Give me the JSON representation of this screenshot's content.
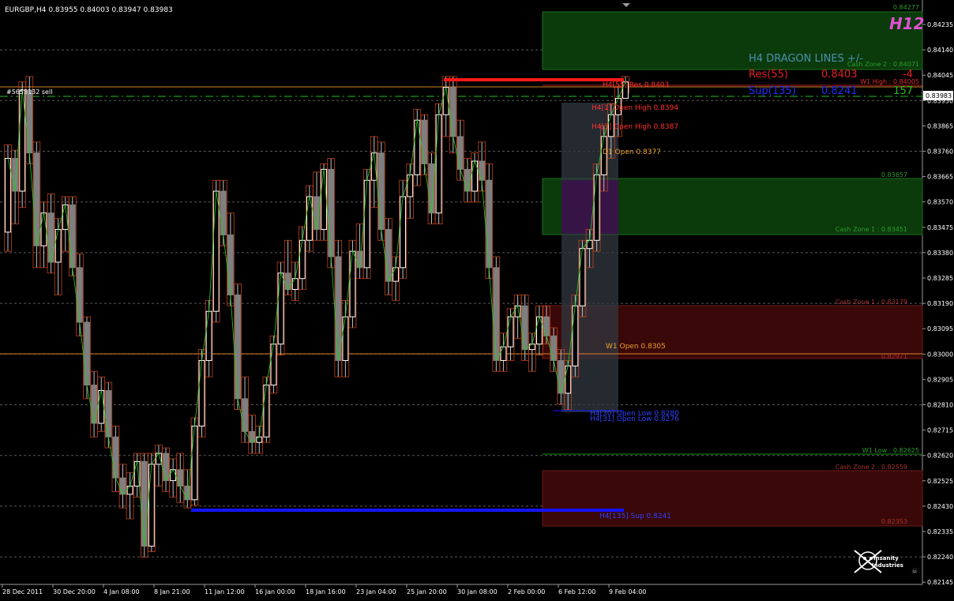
{
  "header": {
    "symbol_line": "EURGBP,H4  0.83955 0.84003 0.83947 0.83983",
    "order_label": "#5653132 sell"
  },
  "price_axis": {
    "ticks": [
      "0.84235",
      "0.84140",
      "0.84045",
      "0.83950",
      "0.83865",
      "0.83760",
      "0.83665",
      "0.83570",
      "0.83475",
      "0.83380",
      "0.83285",
      "0.83190",
      "0.83095",
      "0.83000",
      "0.82905",
      "0.82810",
      "0.82715",
      "0.82620",
      "0.82525",
      "0.82430",
      "0.82335",
      "0.82240",
      "0.82145"
    ],
    "current_price": "0.83983",
    "top_value": "0.84277"
  },
  "time_axis": {
    "ticks": [
      "28 Dec 2011",
      "30 Dec 20:00",
      "4 Jan 08:00",
      "8 Jan 21:00",
      "11 Jan 12:00",
      "16 Jan 00:00",
      "18 Jan 16:00",
      "23 Jan 04:00",
      "25 Jan 20:00",
      "30 Jan 08:00",
      "2 Feb 00:00",
      "6 Feb 12:00",
      "9 Feb 04:00"
    ]
  },
  "panel": {
    "timeframe_badge": "H12",
    "title": "H4  DRAGON LINES +/-",
    "res_label": "Res(55)",
    "res_value": "0.8403",
    "res_diff": "-4",
    "sup_label": "Sup(135)",
    "sup_value": "0.8241",
    "sup_diff": "157"
  },
  "zones": {
    "zone_top_value": "0.84277",
    "cash_zone_2_upper": "Cash Zone 2 : 0.84071",
    "w1_high": "W1 High : 0.84005",
    "green_value": "0.83657",
    "cash_zone_1_upper": "Cash Zone 1 : 0.83451",
    "cash_zone_1_lower": "Cash Zone 1 : 0.83179",
    "red_mid_value": "0.82971",
    "w1_low": "W1 Low : 0.82625",
    "cash_zone_2_lower": "Cash Zone 2 : 0.82559",
    "red_bottom_value": "0.82353"
  },
  "lines": {
    "res_line": "H4[55] Res 0.8403",
    "open_high_1": "H4[1] Open High 0.8394",
    "open_high_2": "H4[3] Open High 0.8387",
    "d1_open": "D1 Open 0.8377",
    "w1_open": "W1 Open 0.8305",
    "open_low_1": "H4[30] Open Low 0.8280",
    "open_low_2": "H4[31] Open Low 0.8276",
    "sup_line": "H4[135] Sup 0.8241"
  },
  "logo": {
    "line1": "Insanity",
    "line2": "Industries"
  },
  "colors": {
    "background": "#000000",
    "bull_candle": "#ffffff",
    "bear_candle": "#7f7f7f",
    "resistance": "#ff2020",
    "support": "#1a1aff",
    "zone_green": "#0a3a0a",
    "zone_red": "#3a0808",
    "orange_line": "#d9822b"
  },
  "chart_data": {
    "type": "candlestick",
    "symbol": "EURGBP",
    "timeframe": "H4",
    "ylim": [
      0.8214,
      0.8428
    ],
    "ohlc": [
      [
        0.8343,
        0.8375,
        0.8336,
        0.837
      ],
      [
        0.837,
        0.8373,
        0.8346,
        0.8358
      ],
      [
        0.8358,
        0.8398,
        0.8352,
        0.8395
      ],
      [
        0.8395,
        0.84,
        0.8368,
        0.8372
      ],
      [
        0.8372,
        0.8376,
        0.833,
        0.8338
      ],
      [
        0.8338,
        0.8354,
        0.833,
        0.835
      ],
      [
        0.835,
        0.8357,
        0.8328,
        0.8332
      ],
      [
        0.8332,
        0.8348,
        0.832,
        0.8344
      ],
      [
        0.8344,
        0.8356,
        0.8336,
        0.8353
      ],
      [
        0.8353,
        0.8356,
        0.8327,
        0.833
      ],
      [
        0.833,
        0.8335,
        0.8305,
        0.831
      ],
      [
        0.831,
        0.8312,
        0.8282,
        0.8287
      ],
      [
        0.8287,
        0.8292,
        0.8268,
        0.8273
      ],
      [
        0.8273,
        0.829,
        0.827,
        0.8285
      ],
      [
        0.8285,
        0.8288,
        0.8264,
        0.8268
      ],
      [
        0.8268,
        0.8272,
        0.8248,
        0.8253
      ],
      [
        0.8253,
        0.8258,
        0.8242,
        0.8247
      ],
      [
        0.8247,
        0.8255,
        0.8238,
        0.825
      ],
      [
        0.825,
        0.8262,
        0.8246,
        0.8259
      ],
      [
        0.8259,
        0.8262,
        0.8224,
        0.8228
      ],
      [
        0.8228,
        0.8262,
        0.8226,
        0.8258
      ],
      [
        0.8258,
        0.8265,
        0.825,
        0.8262
      ],
      [
        0.8262,
        0.8264,
        0.8248,
        0.8252
      ],
      [
        0.8252,
        0.826,
        0.8246,
        0.8256
      ],
      [
        0.8256,
        0.8262,
        0.8244,
        0.825
      ],
      [
        0.825,
        0.8256,
        0.8242,
        0.8245
      ],
      [
        0.8245,
        0.8275,
        0.8243,
        0.8272
      ],
      [
        0.8272,
        0.83,
        0.8268,
        0.8296
      ],
      [
        0.8296,
        0.8318,
        0.829,
        0.8314
      ],
      [
        0.8314,
        0.8362,
        0.831,
        0.8358
      ],
      [
        0.8358,
        0.8362,
        0.8338,
        0.8342
      ],
      [
        0.8342,
        0.835,
        0.8316,
        0.832
      ],
      [
        0.832,
        0.8324,
        0.8278,
        0.8282
      ],
      [
        0.8282,
        0.829,
        0.8266,
        0.827
      ],
      [
        0.827,
        0.8276,
        0.8262,
        0.8266
      ],
      [
        0.8266,
        0.8272,
        0.8262,
        0.8268
      ],
      [
        0.8268,
        0.829,
        0.8266,
        0.8287
      ],
      [
        0.8287,
        0.8305,
        0.8284,
        0.8302
      ],
      [
        0.8302,
        0.8332,
        0.8298,
        0.8328
      ],
      [
        0.8328,
        0.834,
        0.832,
        0.8322
      ],
      [
        0.8322,
        0.8332,
        0.8318,
        0.8326
      ],
      [
        0.8326,
        0.8345,
        0.8322,
        0.834
      ],
      [
        0.834,
        0.836,
        0.8336,
        0.8356
      ],
      [
        0.8356,
        0.8365,
        0.834,
        0.8344
      ],
      [
        0.8344,
        0.8368,
        0.834,
        0.8366
      ],
      [
        0.8366,
        0.837,
        0.833,
        0.8334
      ],
      [
        0.8334,
        0.834,
        0.829,
        0.8296
      ],
      [
        0.8296,
        0.8318,
        0.829,
        0.8312
      ],
      [
        0.8312,
        0.834,
        0.8308,
        0.8336
      ],
      [
        0.8336,
        0.8346,
        0.8326,
        0.833
      ],
      [
        0.833,
        0.8366,
        0.8326,
        0.8362
      ],
      [
        0.8362,
        0.8378,
        0.8352,
        0.8372
      ],
      [
        0.8372,
        0.8376,
        0.834,
        0.8344
      ],
      [
        0.8344,
        0.8348,
        0.832,
        0.8325
      ],
      [
        0.8325,
        0.8334,
        0.8318,
        0.833
      ],
      [
        0.833,
        0.8362,
        0.8326,
        0.8356
      ],
      [
        0.8356,
        0.8368,
        0.8348,
        0.8364
      ],
      [
        0.8364,
        0.8388,
        0.836,
        0.8384
      ],
      [
        0.8384,
        0.8386,
        0.8364,
        0.8368
      ],
      [
        0.8368,
        0.8372,
        0.8346,
        0.835
      ],
      [
        0.835,
        0.839,
        0.8346,
        0.8386
      ],
      [
        0.8386,
        0.84,
        0.8378,
        0.8396
      ],
      [
        0.8396,
        0.84,
        0.8372,
        0.8378
      ],
      [
        0.8378,
        0.8384,
        0.8362,
        0.8366
      ],
      [
        0.8366,
        0.837,
        0.8354,
        0.8358
      ],
      [
        0.8358,
        0.8372,
        0.8354,
        0.8369
      ],
      [
        0.8369,
        0.8376,
        0.8358,
        0.8362
      ],
      [
        0.8362,
        0.8368,
        0.8326,
        0.833
      ],
      [
        0.833,
        0.8334,
        0.8292,
        0.8296
      ],
      [
        0.8296,
        0.8306,
        0.8292,
        0.8301
      ],
      [
        0.8301,
        0.8315,
        0.8296,
        0.8312
      ],
      [
        0.8312,
        0.832,
        0.8304,
        0.8316
      ],
      [
        0.8316,
        0.832,
        0.8296,
        0.83
      ],
      [
        0.83,
        0.8306,
        0.8292,
        0.8302
      ],
      [
        0.8302,
        0.8316,
        0.8298,
        0.8312
      ],
      [
        0.8312,
        0.8316,
        0.8302,
        0.8305
      ],
      [
        0.8305,
        0.8308,
        0.8292,
        0.8296
      ],
      [
        0.8296,
        0.83,
        0.828,
        0.8284
      ],
      [
        0.8284,
        0.8296,
        0.8278,
        0.8294
      ],
      [
        0.8294,
        0.832,
        0.829,
        0.8316
      ],
      [
        0.8316,
        0.834,
        0.8312,
        0.8337
      ],
      [
        0.8337,
        0.8344,
        0.833,
        0.834
      ],
      [
        0.834,
        0.8368,
        0.8336,
        0.8364
      ],
      [
        0.8364,
        0.8382,
        0.8358,
        0.8378
      ],
      [
        0.8378,
        0.839,
        0.837,
        0.8386
      ],
      [
        0.8386,
        0.8396,
        0.8378,
        0.8392
      ],
      [
        0.8392,
        0.84,
        0.8394,
        0.8398
      ]
    ],
    "levels": {
      "resistance": 0.8403,
      "support": 0.8241,
      "w1_open": 0.8305,
      "d1_open": 0.8377,
      "w1_high": 0.84005,
      "w1_low": 0.82625,
      "current": 0.83983
    }
  }
}
